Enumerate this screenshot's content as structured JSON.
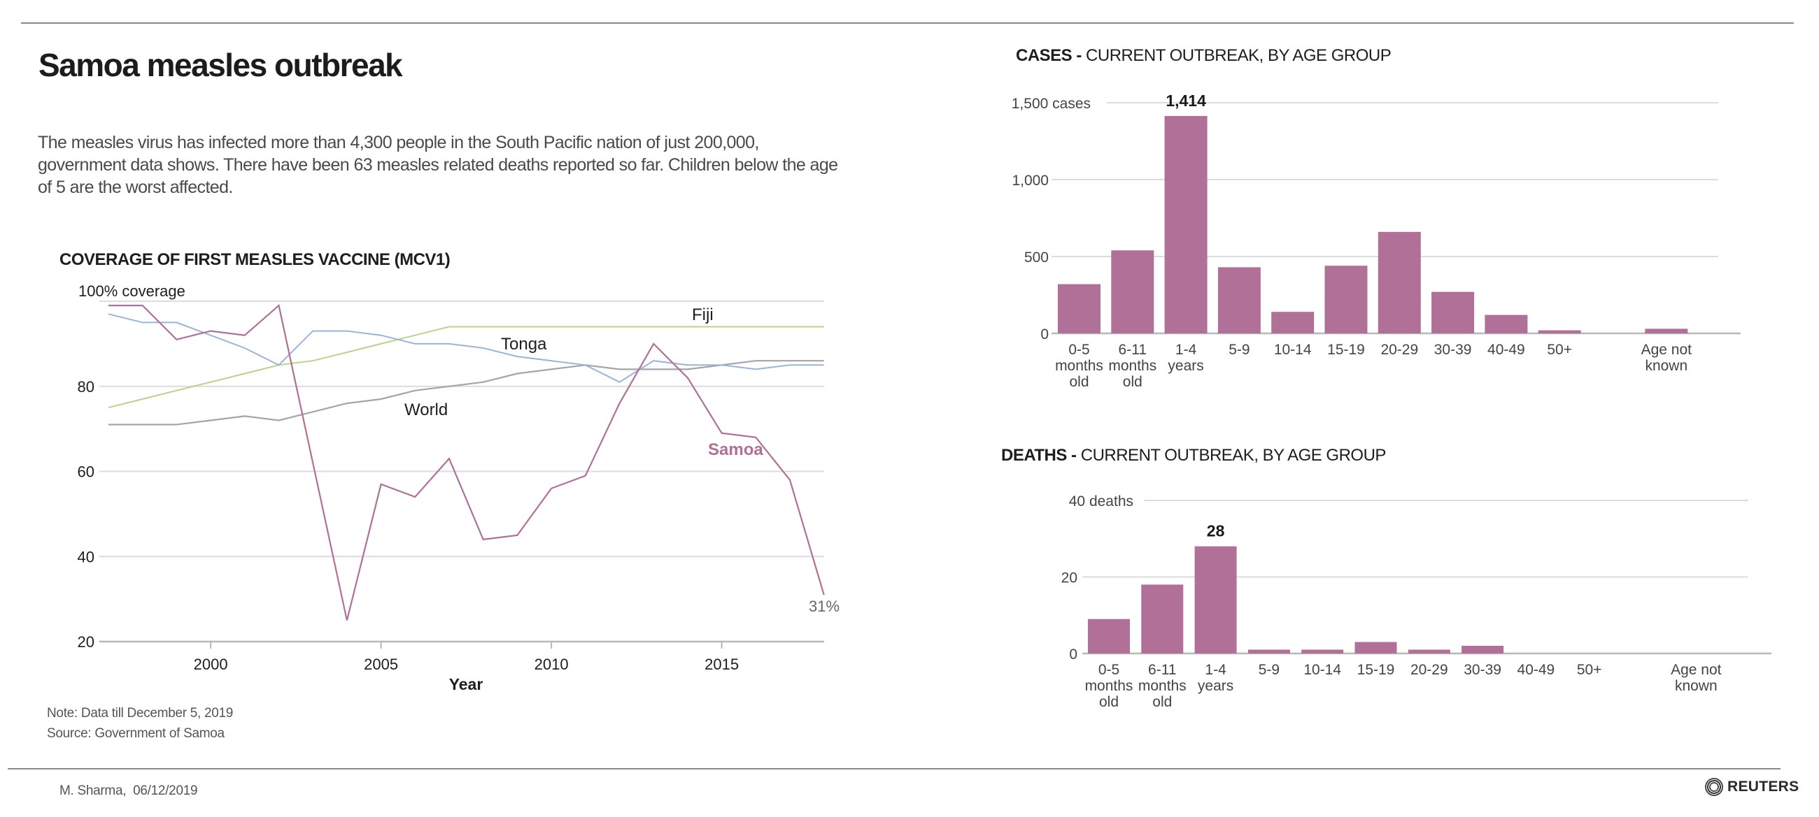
{
  "header": {
    "title": "Samoa measles outbreak",
    "intro": "The measles virus has infected more than 4,300 people in the South Pacific nation of just 200,000, government data shows. There have been 63 measles related deaths reported so far. Children below the age of 5 are the worst affected."
  },
  "footer": {
    "note": "Note: Data till December 5, 2019",
    "source": "Source: Government of Samoa",
    "credit": "M. Sharma,  06/12/2019",
    "logo_text": "REUTERS"
  },
  "colors": {
    "samoa": "#b0709a",
    "tonga": "#9bb5d8",
    "fiji": "#b6d48a",
    "world": "#a8a3a8",
    "bar": "#b07098",
    "grid": "#dcdcdc",
    "axis": "#b8b8b8"
  },
  "chart_data": [
    {
      "type": "line",
      "title": "COVERAGE OF FIRST MEASLES VACCINE (MCV1)",
      "xlabel": "Year",
      "ylabel": "",
      "y_top_label": "100% coverage",
      "ylim": [
        20,
        100
      ],
      "xlim": [
        1996.7,
        2018
      ],
      "yticks": [
        20,
        40,
        60,
        80,
        100
      ],
      "ytick_labels": [
        "20",
        "40",
        "60",
        "80",
        "100% coverage"
      ],
      "xticks": [
        2000,
        2005,
        2010,
        2015
      ],
      "xtick_labels": [
        "2000",
        "2005",
        "2010",
        "2015"
      ],
      "grid": true,
      "x": [
        1997,
        1998,
        1999,
        2000,
        2001,
        2002,
        2003,
        2004,
        2005,
        2006,
        2007,
        2008,
        2009,
        2010,
        2011,
        2012,
        2013,
        2014,
        2015,
        2016,
        2017,
        2018
      ],
      "series": [
        {
          "name": "World",
          "label": "World",
          "values": [
            71,
            71,
            71,
            72,
            73,
            72,
            74,
            76,
            77,
            79,
            80,
            81,
            83,
            84,
            85,
            84,
            84,
            84,
            85,
            86,
            86,
            86
          ]
        },
        {
          "name": "Fiji",
          "label": "Fiji",
          "values": [
            75,
            77,
            79,
            81,
            83,
            85,
            86,
            88,
            90,
            92,
            94,
            94,
            94,
            94,
            94,
            94,
            94,
            94,
            94,
            94,
            94,
            94
          ]
        },
        {
          "name": "Tonga",
          "label": "Tonga",
          "values": [
            97,
            95,
            95,
            92,
            89,
            85,
            93,
            93,
            92,
            90,
            90,
            89,
            87,
            86,
            85,
            81,
            86,
            85,
            85,
            84,
            85,
            85
          ]
        },
        {
          "name": "Samoa",
          "label": "Samoa",
          "values": [
            99,
            99,
            91,
            93,
            92,
            99,
            62,
            25,
            57,
            54,
            63,
            44,
            45,
            56,
            59,
            76,
            90,
            82,
            69,
            68,
            58,
            31
          ]
        }
      ],
      "annotations": [
        {
          "text": "31%",
          "series": "Samoa",
          "x": 2018,
          "y": 31
        }
      ]
    },
    {
      "type": "bar",
      "title_bold": "CASES -",
      "title_rest": " CURRENT OUTBREAK, BY AGE GROUP",
      "categories": [
        [
          "0-5",
          "months",
          "old"
        ],
        [
          "6-11",
          "months",
          "old"
        ],
        [
          "1-4",
          "years"
        ],
        [
          "5-9"
        ],
        [
          "10-14"
        ],
        [
          "15-19"
        ],
        [
          "20-29"
        ],
        [
          "30-39"
        ],
        [
          "40-49"
        ],
        [
          "50+"
        ],
        [
          ""
        ],
        [
          "Age not",
          "known"
        ]
      ],
      "values": [
        320,
        540,
        1414,
        430,
        140,
        440,
        660,
        270,
        120,
        20,
        0,
        30
      ],
      "ylim": [
        0,
        1500
      ],
      "yticks": [
        0,
        500,
        1000,
        1500
      ],
      "ytick_labels": [
        "0",
        "500",
        "1,000",
        "1,500 cases"
      ],
      "data_labels": [
        {
          "index": 2,
          "text": "1,414"
        }
      ],
      "grid": true
    },
    {
      "type": "bar",
      "title_bold": "DEATHS -",
      "title_rest": " CURRENT OUTBREAK, BY AGE GROUP",
      "categories": [
        [
          "0-5",
          "months",
          "old"
        ],
        [
          "6-11",
          "months",
          "old"
        ],
        [
          "1-4",
          "years"
        ],
        [
          "5-9"
        ],
        [
          "10-14"
        ],
        [
          "15-19"
        ],
        [
          "20-29"
        ],
        [
          "30-39"
        ],
        [
          "40-49"
        ],
        [
          "50+"
        ],
        [
          ""
        ],
        [
          "Age not",
          "known"
        ]
      ],
      "values": [
        9,
        18,
        28,
        1,
        1,
        3,
        1,
        2,
        0,
        0,
        0,
        0
      ],
      "ylim": [
        0,
        40
      ],
      "yticks": [
        0,
        20,
        40
      ],
      "ytick_labels": [
        "0",
        "20",
        "40 deaths"
      ],
      "data_labels": [
        {
          "index": 2,
          "text": "28"
        }
      ],
      "grid": true
    }
  ]
}
